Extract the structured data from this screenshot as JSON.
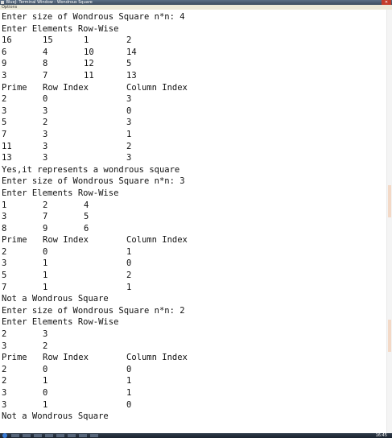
{
  "window": {
    "title": "BlueJ: Terminal Window - Wondrous Square",
    "close_label": "✕"
  },
  "menubar": {
    "items": [
      "Options"
    ]
  },
  "console": {
    "lines": [
      [
        "Enter size of Wondrous Square n*n: 4"
      ],
      [
        "Enter Elements Row-Wise"
      ],
      [
        "16",
        "15",
        "1",
        "2"
      ],
      [
        "6",
        "4",
        "10",
        "14"
      ],
      [
        "9",
        "8",
        "12",
        "5"
      ],
      [
        "3",
        "7",
        "11",
        "13"
      ],
      [
        "Prime",
        "Row Index",
        "",
        "Column Index"
      ],
      [
        "2",
        "0",
        "",
        "3"
      ],
      [
        "3",
        "3",
        "",
        "0"
      ],
      [
        "5",
        "2",
        "",
        "3"
      ],
      [
        "7",
        "3",
        "",
        "1"
      ],
      [
        "11",
        "3",
        "",
        "2"
      ],
      [
        "13",
        "3",
        "",
        "3"
      ],
      [
        "Yes,it represents a wondrous square"
      ],
      [
        "Enter size of Wondrous Square n*n: 3"
      ],
      [
        "Enter Elements Row-Wise"
      ],
      [
        "1",
        "2",
        "4"
      ],
      [
        "3",
        "7",
        "5"
      ],
      [
        "8",
        "9",
        "6"
      ],
      [
        "Prime",
        "Row Index",
        "",
        "Column Index"
      ],
      [
        "2",
        "0",
        "",
        "1"
      ],
      [
        "3",
        "1",
        "",
        "0"
      ],
      [
        "5",
        "1",
        "",
        "2"
      ],
      [
        "7",
        "1",
        "",
        "1"
      ],
      [
        "Not a Wondrous Square"
      ],
      [
        "Enter size of Wondrous Square n*n: 2"
      ],
      [
        "Enter Elements Row-Wise"
      ],
      [
        "2",
        "3"
      ],
      [
        "3",
        "2"
      ],
      [
        "Prime",
        "Row Index",
        "",
        "Column Index"
      ],
      [
        "2",
        "0",
        "",
        "0"
      ],
      [
        "2",
        "1",
        "",
        "1"
      ],
      [
        "3",
        "0",
        "",
        "1"
      ],
      [
        "3",
        "1",
        "",
        "0"
      ],
      [
        "Not a Wondrous Square"
      ]
    ]
  },
  "taskbar": {
    "clock": "16:45"
  }
}
